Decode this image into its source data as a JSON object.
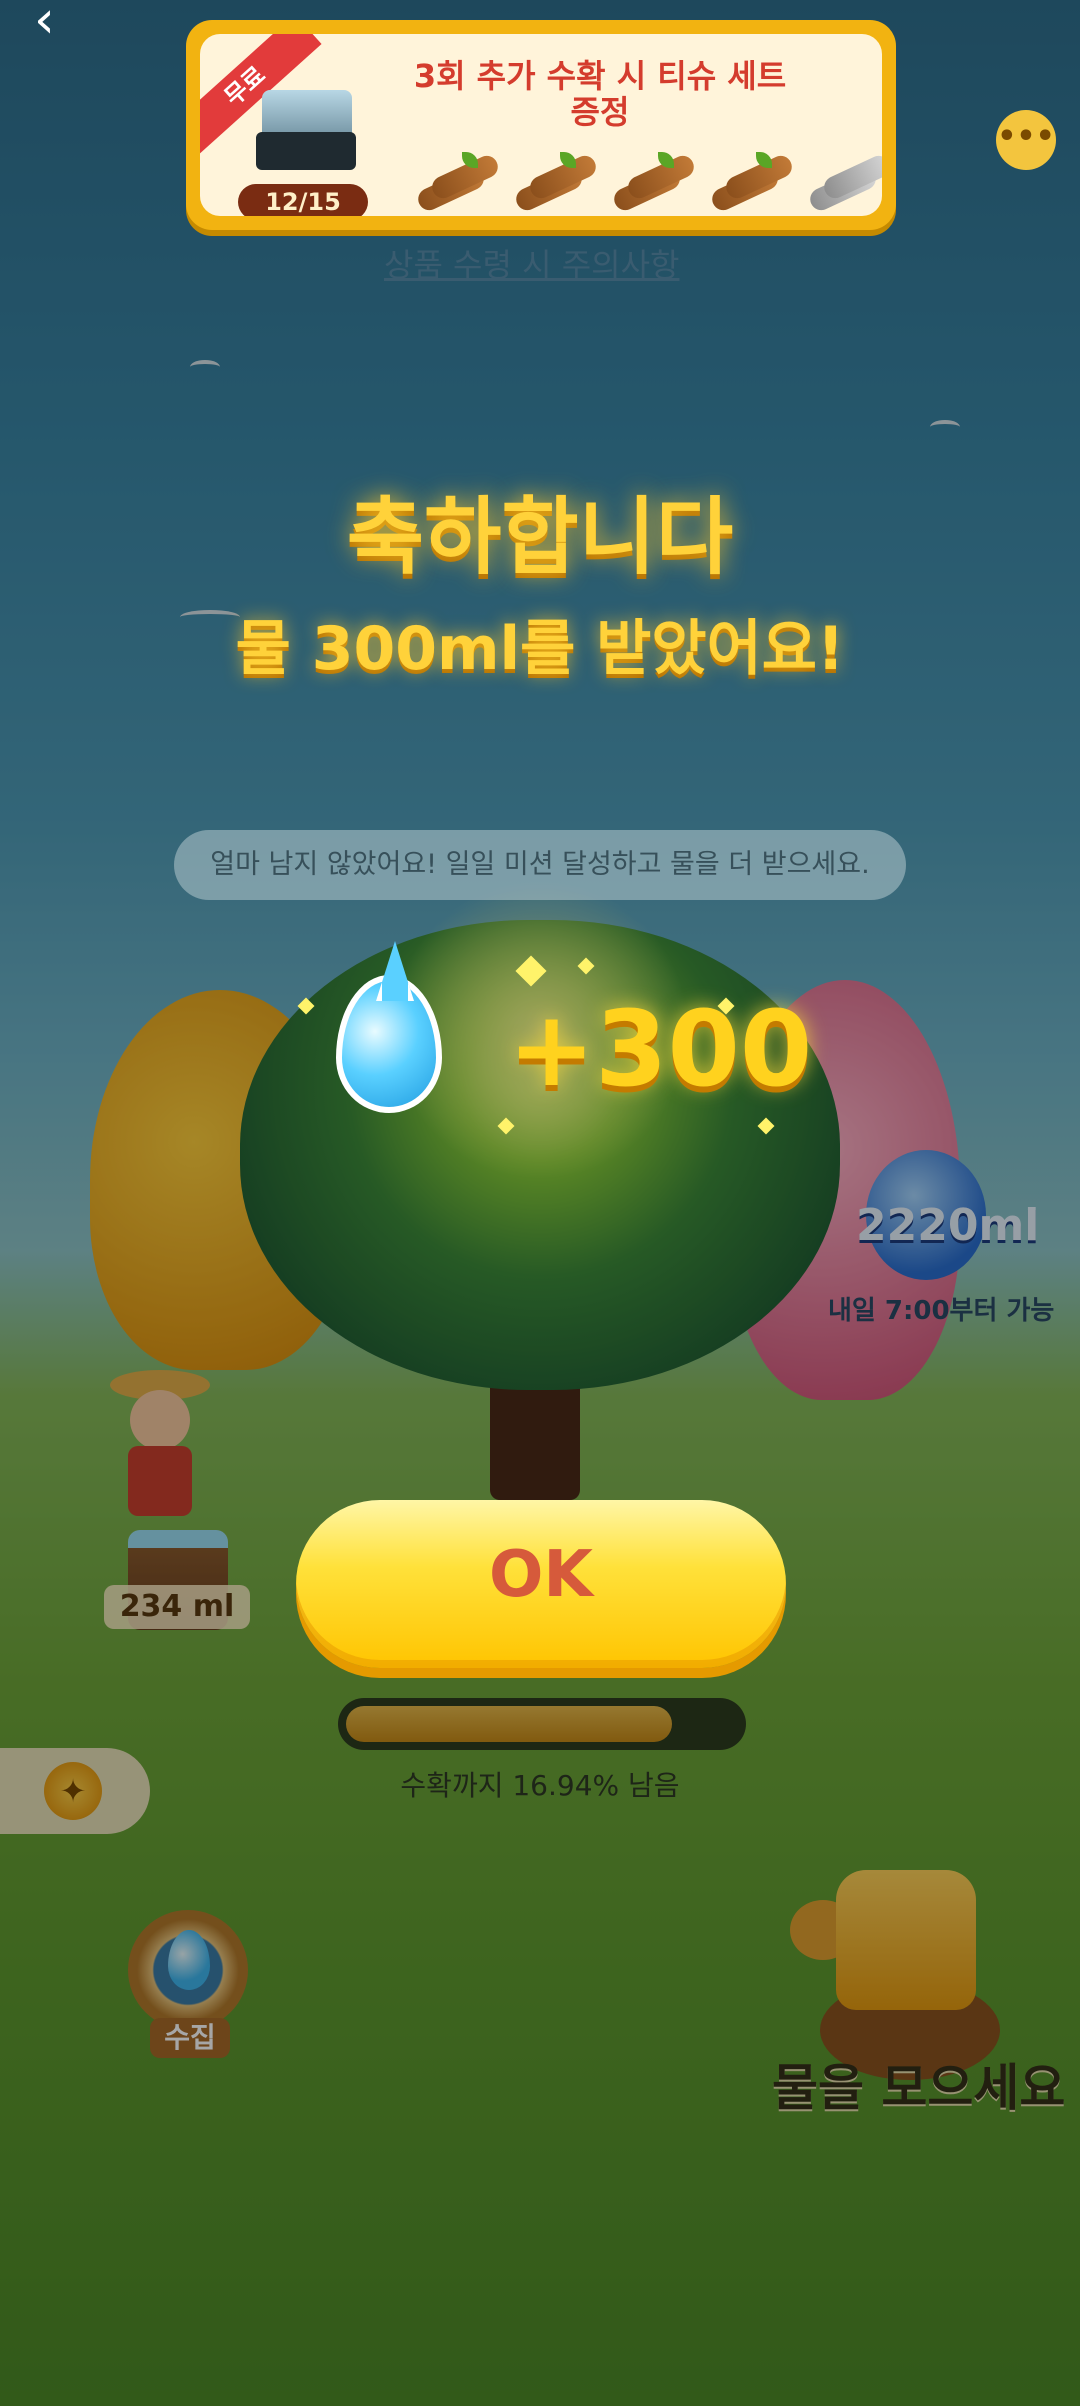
{
  "banner": {
    "ribbon": "무료",
    "progress": "12/15",
    "title": "3회 추가 수확 시 티슈 세트 증정",
    "logs_collected": 4,
    "logs_total": 5
  },
  "notice_link": "상품 수령 시 주의사항",
  "popup": {
    "title": "축하합니다",
    "message": "물 300ml를 받았어요!",
    "reward_amount": "+300",
    "ok_label": "OK"
  },
  "mission_text": "얼마 남지 않았어요! 일일 미션 달성하고 물을 더 받으세요.",
  "potion": {
    "amount": "2220ml",
    "available_time": "내일 7:00부터 가능"
  },
  "bucket": {
    "amount": "234 ml"
  },
  "harvest": {
    "progress_fraction": 0.8306,
    "remaining_text": "수확까지 16.94% 남음"
  },
  "collect": {
    "label": "수집"
  },
  "watering": {
    "label": "물을 모으세요"
  },
  "icons": {
    "back": "back-arrow-icon",
    "more": "more-icon",
    "coin": "coin-icon"
  },
  "colors": {
    "gold_text": "#ffd23a",
    "ok_button": "#ffe13a",
    "ok_text": "#d65a3b",
    "banner_title": "#d43c2d"
  }
}
